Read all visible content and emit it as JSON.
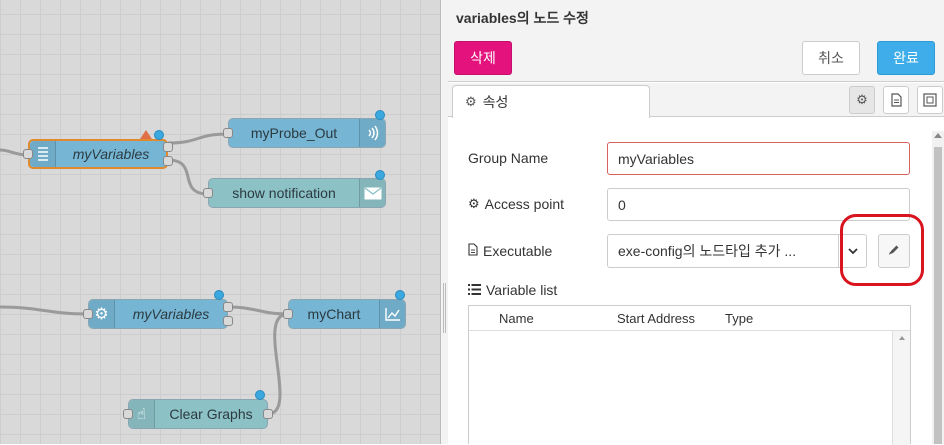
{
  "canvas": {
    "nodes": [
      {
        "id": "variables1",
        "label": "myVariables",
        "icon": "list-icon",
        "color": "#76b6d4"
      },
      {
        "id": "probe",
        "label": "myProbe_Out",
        "icon": "signal-icon",
        "color": "#76b6d4"
      },
      {
        "id": "notify",
        "label": "show notification",
        "icon": "envelope-icon",
        "color": "#8cc1c6"
      },
      {
        "id": "variables2",
        "label": "myVariables",
        "icon": "gear-icon",
        "color": "#76b6d4"
      },
      {
        "id": "chart",
        "label": "myChart",
        "icon": "chart-icon",
        "color": "#76b6d4"
      },
      {
        "id": "clear",
        "label": "Clear Graphs",
        "icon": "hand-pointer-icon",
        "color": "#8cc1c6"
      }
    ]
  },
  "tray": {
    "title": "variables의 노드 수정",
    "delete_label": "삭제",
    "cancel_label": "취소",
    "done_label": "완료",
    "tab_properties": "속성",
    "fields": {
      "group_name_label": "Group Name",
      "group_name_value": "myVariables",
      "access_point_label": "Access point",
      "access_point_value": "0",
      "executable_label": "Executable",
      "executable_value": "exe-config의 노드타입 추가 ...",
      "variable_list_label": "Variable list"
    },
    "table_headers": {
      "name": "Name",
      "start_address": "Start Address",
      "type": "Type"
    }
  },
  "colors": {
    "delete": "#e3127c",
    "done": "#3fadea",
    "highlight": "#d9141f",
    "node_blue": "#76b6d4",
    "node_teal": "#8cc1c6",
    "port_dot": "#3ca8e0"
  }
}
